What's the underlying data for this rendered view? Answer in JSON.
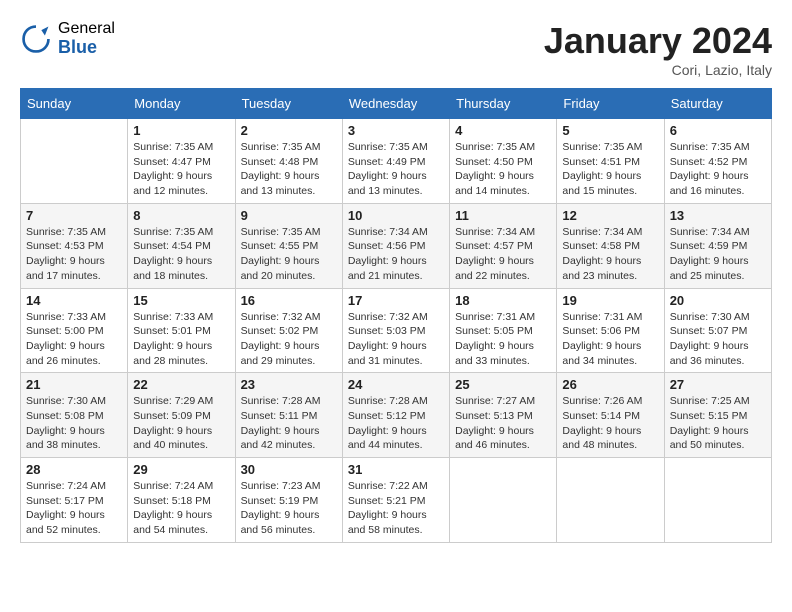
{
  "logo": {
    "general": "General",
    "blue": "Blue"
  },
  "title": "January 2024",
  "location": "Cori, Lazio, Italy",
  "days_of_week": [
    "Sunday",
    "Monday",
    "Tuesday",
    "Wednesday",
    "Thursday",
    "Friday",
    "Saturday"
  ],
  "weeks": [
    [
      {
        "day": "",
        "info": ""
      },
      {
        "day": "1",
        "info": "Sunrise: 7:35 AM\nSunset: 4:47 PM\nDaylight: 9 hours\nand 12 minutes."
      },
      {
        "day": "2",
        "info": "Sunrise: 7:35 AM\nSunset: 4:48 PM\nDaylight: 9 hours\nand 13 minutes."
      },
      {
        "day": "3",
        "info": "Sunrise: 7:35 AM\nSunset: 4:49 PM\nDaylight: 9 hours\nand 13 minutes."
      },
      {
        "day": "4",
        "info": "Sunrise: 7:35 AM\nSunset: 4:50 PM\nDaylight: 9 hours\nand 14 minutes."
      },
      {
        "day": "5",
        "info": "Sunrise: 7:35 AM\nSunset: 4:51 PM\nDaylight: 9 hours\nand 15 minutes."
      },
      {
        "day": "6",
        "info": "Sunrise: 7:35 AM\nSunset: 4:52 PM\nDaylight: 9 hours\nand 16 minutes."
      }
    ],
    [
      {
        "day": "7",
        "info": "Sunrise: 7:35 AM\nSunset: 4:53 PM\nDaylight: 9 hours\nand 17 minutes."
      },
      {
        "day": "8",
        "info": "Sunrise: 7:35 AM\nSunset: 4:54 PM\nDaylight: 9 hours\nand 18 minutes."
      },
      {
        "day": "9",
        "info": "Sunrise: 7:35 AM\nSunset: 4:55 PM\nDaylight: 9 hours\nand 20 minutes."
      },
      {
        "day": "10",
        "info": "Sunrise: 7:34 AM\nSunset: 4:56 PM\nDaylight: 9 hours\nand 21 minutes."
      },
      {
        "day": "11",
        "info": "Sunrise: 7:34 AM\nSunset: 4:57 PM\nDaylight: 9 hours\nand 22 minutes."
      },
      {
        "day": "12",
        "info": "Sunrise: 7:34 AM\nSunset: 4:58 PM\nDaylight: 9 hours\nand 23 minutes."
      },
      {
        "day": "13",
        "info": "Sunrise: 7:34 AM\nSunset: 4:59 PM\nDaylight: 9 hours\nand 25 minutes."
      }
    ],
    [
      {
        "day": "14",
        "info": "Sunrise: 7:33 AM\nSunset: 5:00 PM\nDaylight: 9 hours\nand 26 minutes."
      },
      {
        "day": "15",
        "info": "Sunrise: 7:33 AM\nSunset: 5:01 PM\nDaylight: 9 hours\nand 28 minutes."
      },
      {
        "day": "16",
        "info": "Sunrise: 7:32 AM\nSunset: 5:02 PM\nDaylight: 9 hours\nand 29 minutes."
      },
      {
        "day": "17",
        "info": "Sunrise: 7:32 AM\nSunset: 5:03 PM\nDaylight: 9 hours\nand 31 minutes."
      },
      {
        "day": "18",
        "info": "Sunrise: 7:31 AM\nSunset: 5:05 PM\nDaylight: 9 hours\nand 33 minutes."
      },
      {
        "day": "19",
        "info": "Sunrise: 7:31 AM\nSunset: 5:06 PM\nDaylight: 9 hours\nand 34 minutes."
      },
      {
        "day": "20",
        "info": "Sunrise: 7:30 AM\nSunset: 5:07 PM\nDaylight: 9 hours\nand 36 minutes."
      }
    ],
    [
      {
        "day": "21",
        "info": "Sunrise: 7:30 AM\nSunset: 5:08 PM\nDaylight: 9 hours\nand 38 minutes."
      },
      {
        "day": "22",
        "info": "Sunrise: 7:29 AM\nSunset: 5:09 PM\nDaylight: 9 hours\nand 40 minutes."
      },
      {
        "day": "23",
        "info": "Sunrise: 7:28 AM\nSunset: 5:11 PM\nDaylight: 9 hours\nand 42 minutes."
      },
      {
        "day": "24",
        "info": "Sunrise: 7:28 AM\nSunset: 5:12 PM\nDaylight: 9 hours\nand 44 minutes."
      },
      {
        "day": "25",
        "info": "Sunrise: 7:27 AM\nSunset: 5:13 PM\nDaylight: 9 hours\nand 46 minutes."
      },
      {
        "day": "26",
        "info": "Sunrise: 7:26 AM\nSunset: 5:14 PM\nDaylight: 9 hours\nand 48 minutes."
      },
      {
        "day": "27",
        "info": "Sunrise: 7:25 AM\nSunset: 5:15 PM\nDaylight: 9 hours\nand 50 minutes."
      }
    ],
    [
      {
        "day": "28",
        "info": "Sunrise: 7:24 AM\nSunset: 5:17 PM\nDaylight: 9 hours\nand 52 minutes."
      },
      {
        "day": "29",
        "info": "Sunrise: 7:24 AM\nSunset: 5:18 PM\nDaylight: 9 hours\nand 54 minutes."
      },
      {
        "day": "30",
        "info": "Sunrise: 7:23 AM\nSunset: 5:19 PM\nDaylight: 9 hours\nand 56 minutes."
      },
      {
        "day": "31",
        "info": "Sunrise: 7:22 AM\nSunset: 5:21 PM\nDaylight: 9 hours\nand 58 minutes."
      },
      {
        "day": "",
        "info": ""
      },
      {
        "day": "",
        "info": ""
      },
      {
        "day": "",
        "info": ""
      }
    ]
  ]
}
